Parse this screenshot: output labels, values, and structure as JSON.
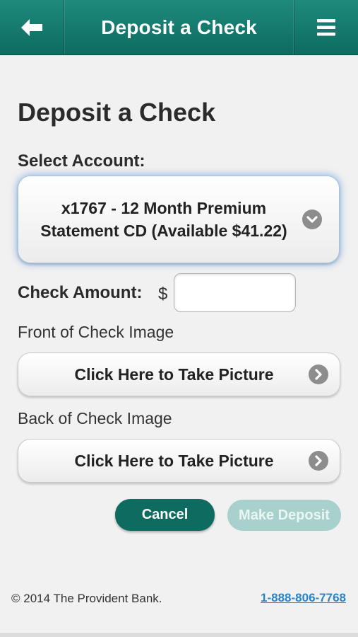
{
  "header": {
    "title": "Deposit a Check",
    "back_icon": "arrow-left-icon",
    "menu_icon": "hamburger-menu-icon",
    "color": "#0d6b60"
  },
  "main": {
    "page_title": "Deposit a Check",
    "select_account_label": "Select Account:",
    "selected_account": "x1767 - 12 Month Premium Statement CD (Available $41.22)",
    "check_amount_label": "Check Amount:",
    "currency_symbol": "$",
    "check_amount_value": "",
    "front_label": "Front of Check Image",
    "front_button": "Click Here to Take Picture",
    "back_label": "Back of Check Image",
    "back_button": "Click Here to Take Picture",
    "cancel_button": "Cancel",
    "deposit_button": "Make Deposit"
  },
  "footer": {
    "copyright": "© 2014 The Provident Bank.",
    "phone": "1-888-806-7768"
  },
  "colors": {
    "accent": "#0d6b60",
    "disabled_button": "#a8d1cd",
    "link": "#2a84c6"
  }
}
